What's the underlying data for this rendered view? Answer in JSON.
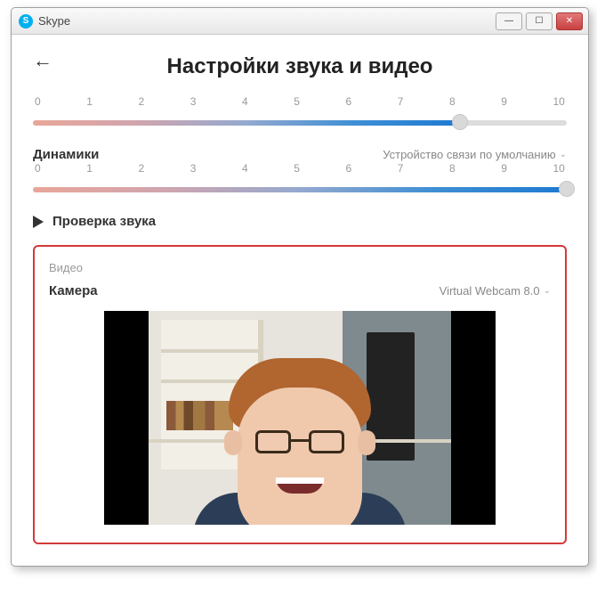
{
  "titlebar": {
    "app": "Skype"
  },
  "page": {
    "title": "Настройки звука и видео"
  },
  "mic_slider": {
    "ticks": [
      "0",
      "1",
      "2",
      "3",
      "4",
      "5",
      "6",
      "7",
      "8",
      "9",
      "10"
    ],
    "value": 8,
    "max": 10
  },
  "speakers": {
    "label": "Динамики",
    "device": "Устройство связи по умолчанию"
  },
  "speaker_slider": {
    "ticks": [
      "0",
      "1",
      "2",
      "3",
      "4",
      "5",
      "6",
      "7",
      "8",
      "9",
      "10"
    ],
    "value": 10,
    "max": 10
  },
  "sound_test": {
    "label": "Проверка звука"
  },
  "video": {
    "section": "Видео",
    "camera_label": "Камера",
    "camera_device": "Virtual Webcam 8.0"
  }
}
